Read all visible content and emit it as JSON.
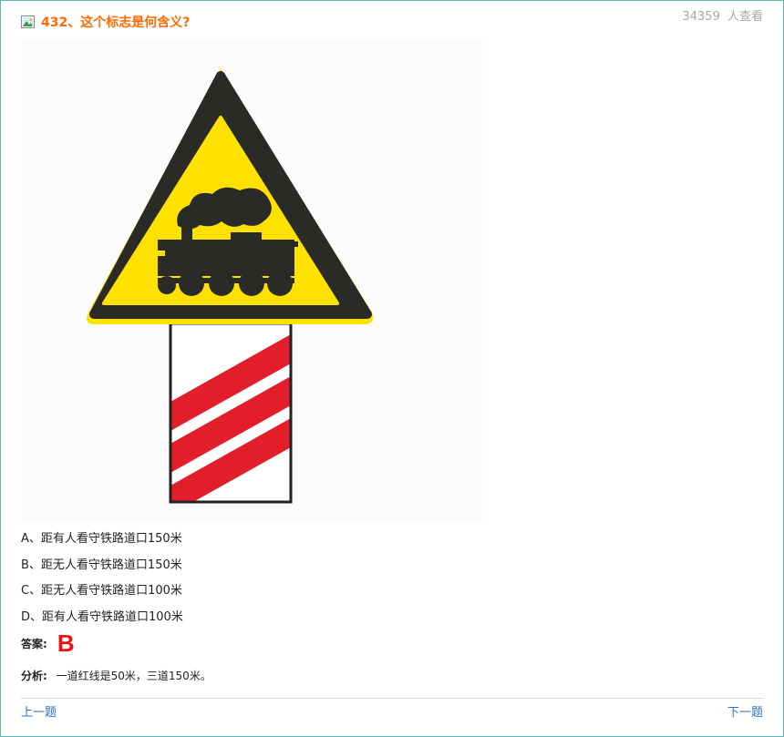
{
  "question": {
    "title": "432、这个标志是何含义?",
    "views_count": "34359",
    "views_label": "人查看"
  },
  "image": {
    "icon": "question-image-icon",
    "subject": "railway-crossing-warning-sign"
  },
  "options": [
    "A、距有人看守铁路道口150米",
    "B、距无人看守铁路道口150米",
    "C、距无人看守铁路道口100米",
    "D、距有人看守铁路道口100米"
  ],
  "answer": {
    "label": "答案:",
    "value": "B"
  },
  "analysis": {
    "label": "分析:",
    "text": "一道红线是50米，三道150米。"
  },
  "nav": {
    "prev": "上一题",
    "next": "下一题"
  },
  "colors": {
    "title": "#ff6a00",
    "answer": "#ee1111",
    "link": "#2f6fcc",
    "sign_yellow": "#ffe100",
    "sign_red": "#e31e2b"
  }
}
